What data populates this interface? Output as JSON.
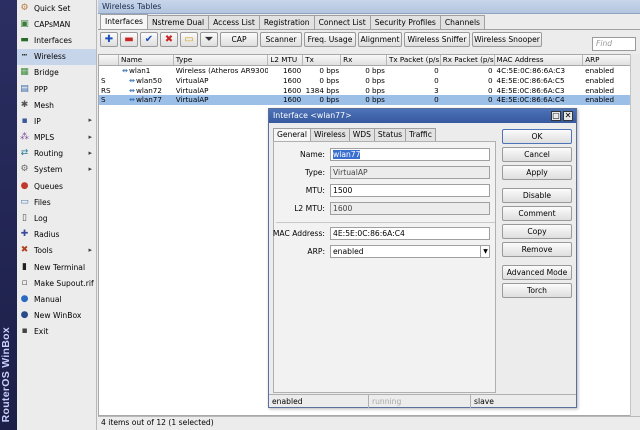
{
  "brand": "RouterOS WinBox",
  "sidebar": {
    "items": [
      {
        "label": "Quick Set",
        "icon": "quickset-icon",
        "glyph": "⚙",
        "color": "#b87a3a",
        "arrow": false,
        "selected": false
      },
      {
        "label": "CAPsMAN",
        "icon": "capsman-icon",
        "glyph": "▣",
        "color": "#3a7a3a",
        "arrow": false,
        "selected": false
      },
      {
        "label": "Interfaces",
        "icon": "interfaces-icon",
        "glyph": "▬",
        "color": "#2a6a2a",
        "arrow": false,
        "selected": false
      },
      {
        "label": "Wireless",
        "icon": "wireless-icon",
        "glyph": "┅",
        "color": "#333333",
        "arrow": false,
        "selected": true
      },
      {
        "label": "Bridge",
        "icon": "bridge-icon",
        "glyph": "▦",
        "color": "#3a8a3a",
        "arrow": false,
        "selected": false
      },
      {
        "label": "PPP",
        "icon": "ppp-icon",
        "glyph": "▤",
        "color": "#3a6aaa",
        "arrow": false,
        "selected": false
      },
      {
        "label": "Mesh",
        "icon": "mesh-icon",
        "glyph": "✱",
        "color": "#555555",
        "arrow": false,
        "selected": false
      },
      {
        "label": "IP",
        "icon": "ip-icon",
        "glyph": "▪",
        "color": "#3a5a9a",
        "arrow": true,
        "selected": false
      },
      {
        "label": "MPLS",
        "icon": "mpls-icon",
        "glyph": "⁂",
        "color": "#7a4a9a",
        "arrow": true,
        "selected": false
      },
      {
        "label": "Routing",
        "icon": "routing-icon",
        "glyph": "⇄",
        "color": "#2a7a9a",
        "arrow": true,
        "selected": false
      },
      {
        "label": "System",
        "icon": "system-icon",
        "glyph": "⚙",
        "color": "#666666",
        "arrow": true,
        "selected": false
      },
      {
        "label": "Queues",
        "icon": "queues-icon",
        "glyph": "●",
        "color": "#c0392b",
        "arrow": false,
        "selected": false
      },
      {
        "label": "Files",
        "icon": "files-icon",
        "glyph": "▭",
        "color": "#4a78b0",
        "arrow": false,
        "selected": false
      },
      {
        "label": "Log",
        "icon": "log-icon",
        "glyph": "▯",
        "color": "#555555",
        "arrow": false,
        "selected": false
      },
      {
        "label": "Radius",
        "icon": "radius-icon",
        "glyph": "✚",
        "color": "#3a4a9a",
        "arrow": false,
        "selected": false
      },
      {
        "label": "Tools",
        "icon": "tools-icon",
        "glyph": "✖",
        "color": "#b04020",
        "arrow": true,
        "selected": false
      },
      {
        "label": "New Terminal",
        "icon": "terminal-icon",
        "glyph": "▮",
        "color": "#222222",
        "arrow": false,
        "selected": false
      },
      {
        "label": "Make Supout.rif",
        "icon": "supout-icon",
        "glyph": "▫",
        "color": "#555555",
        "arrow": false,
        "selected": false
      },
      {
        "label": "Manual",
        "icon": "manual-icon",
        "glyph": "●",
        "color": "#2a6ac0",
        "arrow": false,
        "selected": false
      },
      {
        "label": "New WinBox",
        "icon": "winbox-icon",
        "glyph": "●",
        "color": "#2a4a8a",
        "arrow": false,
        "selected": false
      },
      {
        "label": "Exit",
        "icon": "exit-icon",
        "glyph": "▪",
        "color": "#444444",
        "arrow": false,
        "selected": false
      }
    ]
  },
  "window": {
    "title": "Wireless Tables",
    "tabs": [
      "Interfaces",
      "Nstreme Dual",
      "Access List",
      "Registration",
      "Connect List",
      "Security Profiles",
      "Channels"
    ],
    "active_tab": 0,
    "toolbar": {
      "buttons": [
        "CAP",
        "Scanner",
        "Freq. Usage",
        "Alignment",
        "Wireless Sniffer",
        "Wireless Snooper"
      ],
      "find_placeholder": "Find"
    },
    "table": {
      "columns": [
        "",
        "Name",
        "Type",
        "L2 MTU",
        "Tx",
        "Rx",
        "Tx Packet (p/s)",
        "Rx Packet (p/s)",
        "MAC Address",
        "ARP"
      ],
      "rows": [
        {
          "flag": "",
          "name": "wlan1",
          "indent": false,
          "type": "Wireless (Atheros AR9300)",
          "l2mtu": "1600",
          "tx": "0 bps",
          "rx": "0 bps",
          "txp": "0",
          "rxp": "0",
          "mac": "4C:5E:0C:86:6A:C3",
          "arp": "enabled",
          "selected": false
        },
        {
          "flag": "S",
          "name": "wlan50",
          "indent": true,
          "type": "VirtualAP",
          "l2mtu": "1600",
          "tx": "0 bps",
          "rx": "0 bps",
          "txp": "0",
          "rxp": "0",
          "mac": "4E:5E:0C:86:6A:C5",
          "arp": "enabled",
          "selected": false
        },
        {
          "flag": "RS",
          "name": "wlan72",
          "indent": true,
          "type": "VirtualAP",
          "l2mtu": "1600",
          "tx": "1384 bps",
          "rx": "0 bps",
          "txp": "3",
          "rxp": "0",
          "mac": "4E:5E:0C:86:6A:C3",
          "arp": "enabled",
          "selected": false
        },
        {
          "flag": "S",
          "name": "wlan77",
          "indent": true,
          "type": "VirtualAP",
          "l2mtu": "1600",
          "tx": "0 bps",
          "rx": "0 bps",
          "txp": "0",
          "rxp": "0",
          "mac": "4E:5E:0C:86:6A:C4",
          "arp": "enabled",
          "selected": true
        }
      ]
    },
    "status": "4 items out of 12 (1 selected)"
  },
  "dialog": {
    "title": "Interface <wlan77>",
    "tabs": [
      "General",
      "Wireless",
      "WDS",
      "Status",
      "Traffic"
    ],
    "active_tab": 0,
    "fields": {
      "name_label": "Name:",
      "name_value": "wlan77",
      "type_label": "Type:",
      "type_value": "VirtualAP",
      "mtu_label": "MTU:",
      "mtu_value": "1500",
      "l2mtu_label": "L2 MTU:",
      "l2mtu_value": "1600",
      "mac_label": "MAC Address:",
      "mac_value": "4E:5E:0C:86:6A:C4",
      "arp_label": "ARP:",
      "arp_value": "enabled"
    },
    "buttons": {
      "ok": "OK",
      "cancel": "Cancel",
      "apply": "Apply",
      "disable": "Disable",
      "comment": "Comment",
      "copy": "Copy",
      "remove": "Remove",
      "advanced": "Advanced Mode",
      "torch": "Torch"
    },
    "status": {
      "state": "enabled",
      "running": "running",
      "slave": "slave"
    }
  }
}
